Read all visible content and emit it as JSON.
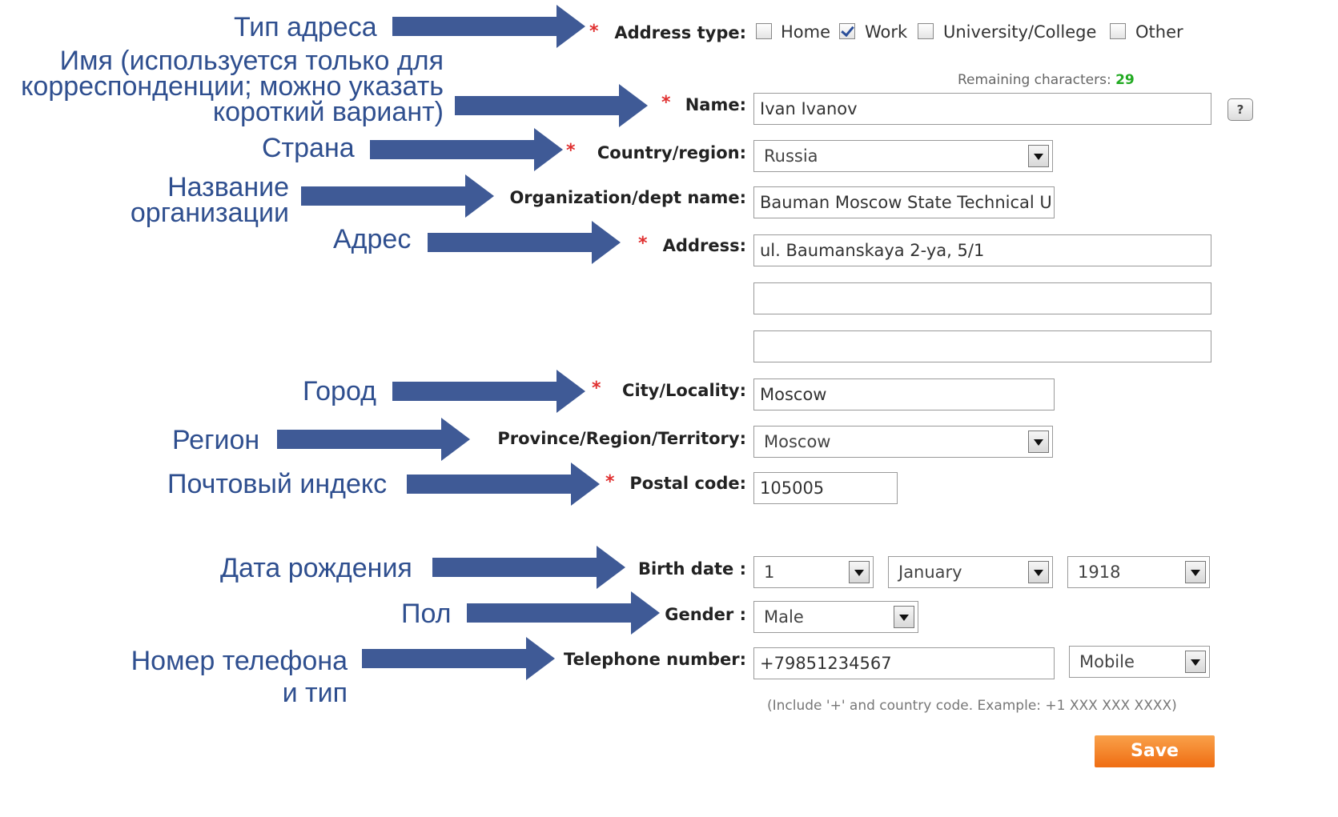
{
  "annotations": {
    "address_type": "Тип адреса",
    "name_line1": "Имя (используется только для",
    "name_line2": "корреспонденции; можно указать",
    "name_line3": "короткий вариант)",
    "country": "Страна",
    "org_line1": "Название",
    "org_line2": "организации",
    "address": "Адрес",
    "city": "Город",
    "region": "Регион",
    "postal": "Почтовый индекс",
    "birth": "Дата рождения",
    "gender": "Пол",
    "phone_line1": "Номер телефона",
    "phone_line2": "и тип"
  },
  "form": {
    "required_mark": "*",
    "address_type": {
      "label": "Address type:",
      "options": [
        {
          "label": "Home",
          "checked": false
        },
        {
          "label": "Work",
          "checked": true
        },
        {
          "label": "University/College",
          "checked": false
        },
        {
          "label": "Other",
          "checked": false
        }
      ]
    },
    "name": {
      "remaining_label": "Remaining characters:",
      "remaining_count": "29",
      "label": "Name:",
      "value": "Ivan Ivanov",
      "help": "?"
    },
    "country": {
      "label": "Country/region:",
      "value": "Russia"
    },
    "organization": {
      "label": "Organization/dept name:",
      "value": "Bauman Moscow State Technical U"
    },
    "address": {
      "label": "Address:",
      "line1": "ul. Baumanskaya 2-ya, 5/1",
      "line2": "",
      "line3": ""
    },
    "city": {
      "label": "City/Locality:",
      "value": "Moscow"
    },
    "province": {
      "label": "Province/Region/Territory:",
      "value": "Moscow"
    },
    "postal": {
      "label": "Postal code:",
      "value": "105005"
    },
    "birth": {
      "label": "Birth date :",
      "day": "1",
      "month": "January",
      "year": "1918"
    },
    "gender": {
      "label": "Gender :",
      "value": "Male"
    },
    "phone": {
      "label": "Telephone number:",
      "value": "+79851234567",
      "type": "Mobile",
      "hint": "(Include '+' and country code. Example: +1 XXX XXX XXXX)"
    },
    "save_label": "Save"
  },
  "colors": {
    "accent": "#3f5a96",
    "required": "#e03030",
    "remaining": "#22aa22",
    "save": "#ef6d12"
  }
}
